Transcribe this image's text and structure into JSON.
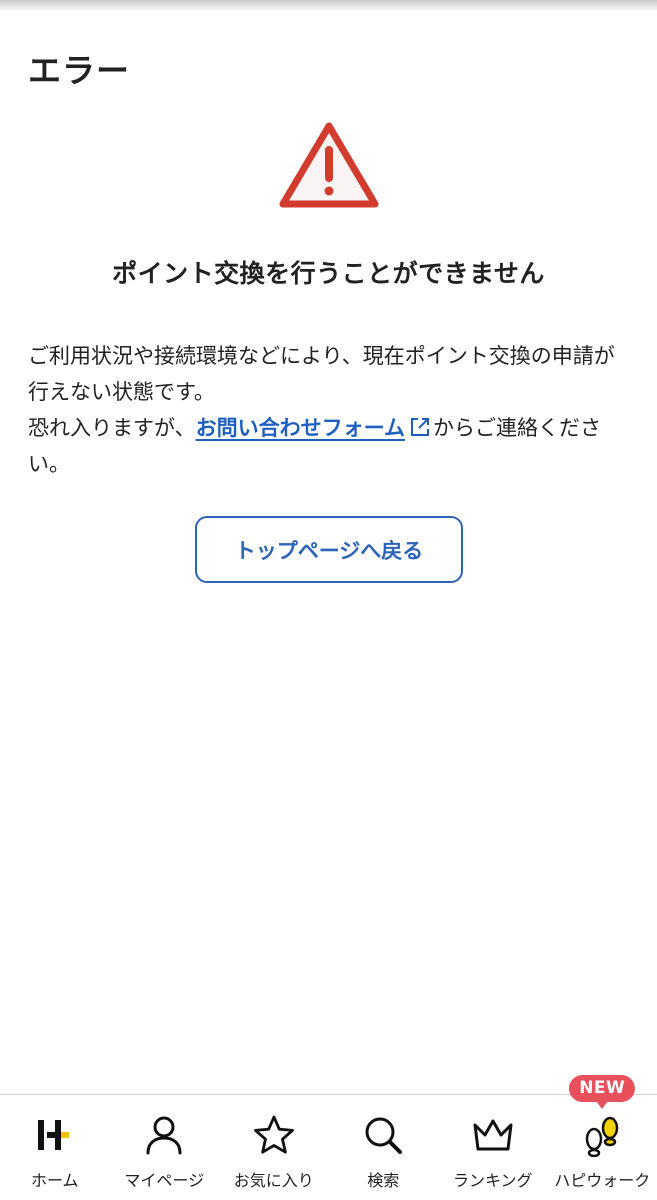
{
  "page": {
    "title": "エラー",
    "heading": "ポイント交換を行うことができません",
    "message_line1": "ご利用状況や接続環境などにより、現在ポイント交換の申請が行えない状態です。",
    "message_prefix": "恐れ入りますが、",
    "contact_link": "お問い合わせフォーム",
    "message_suffix": "からご連絡ください。",
    "top_button": "トップページへ戻る"
  },
  "tabs": {
    "home": "ホーム",
    "mypage": "マイページ",
    "favorites": "お気に入り",
    "search": "検索",
    "ranking": "ランキング",
    "hapiwalk": "ハピウォーク",
    "new_badge": "NEW"
  },
  "colors": {
    "warning": "#d23c2f",
    "link": "#1f5fc2",
    "button_border": "#2d63b8",
    "badge": "#e8505b",
    "home_accent": "#f2c200"
  },
  "icons": [
    "warning-triangle-icon",
    "external-link-icon",
    "home-logo-icon",
    "person-icon",
    "star-icon",
    "search-icon",
    "crown-icon",
    "footprints-icon"
  ]
}
